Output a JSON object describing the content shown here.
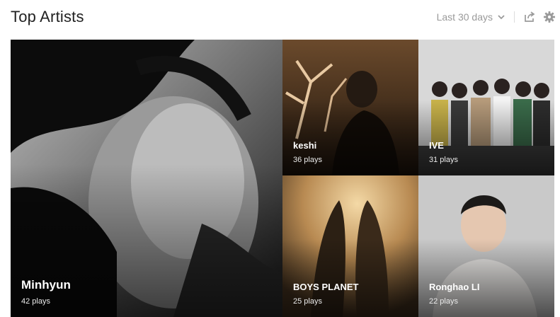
{
  "header": {
    "title": "Top Artists",
    "range_label": "Last 30 days"
  },
  "icons": {
    "dropdown": "chevron-down-icon",
    "share": "share-icon",
    "settings": "gear-icon"
  },
  "artists": [
    {
      "name": "Minhyun",
      "plays": "42 plays"
    },
    {
      "name": "keshi",
      "plays": "36 plays"
    },
    {
      "name": "IVE",
      "plays": "31 plays"
    },
    {
      "name": "BOYS PLANET",
      "plays": "25 plays"
    },
    {
      "name": "Ronghao LI",
      "plays": "22 plays"
    }
  ]
}
